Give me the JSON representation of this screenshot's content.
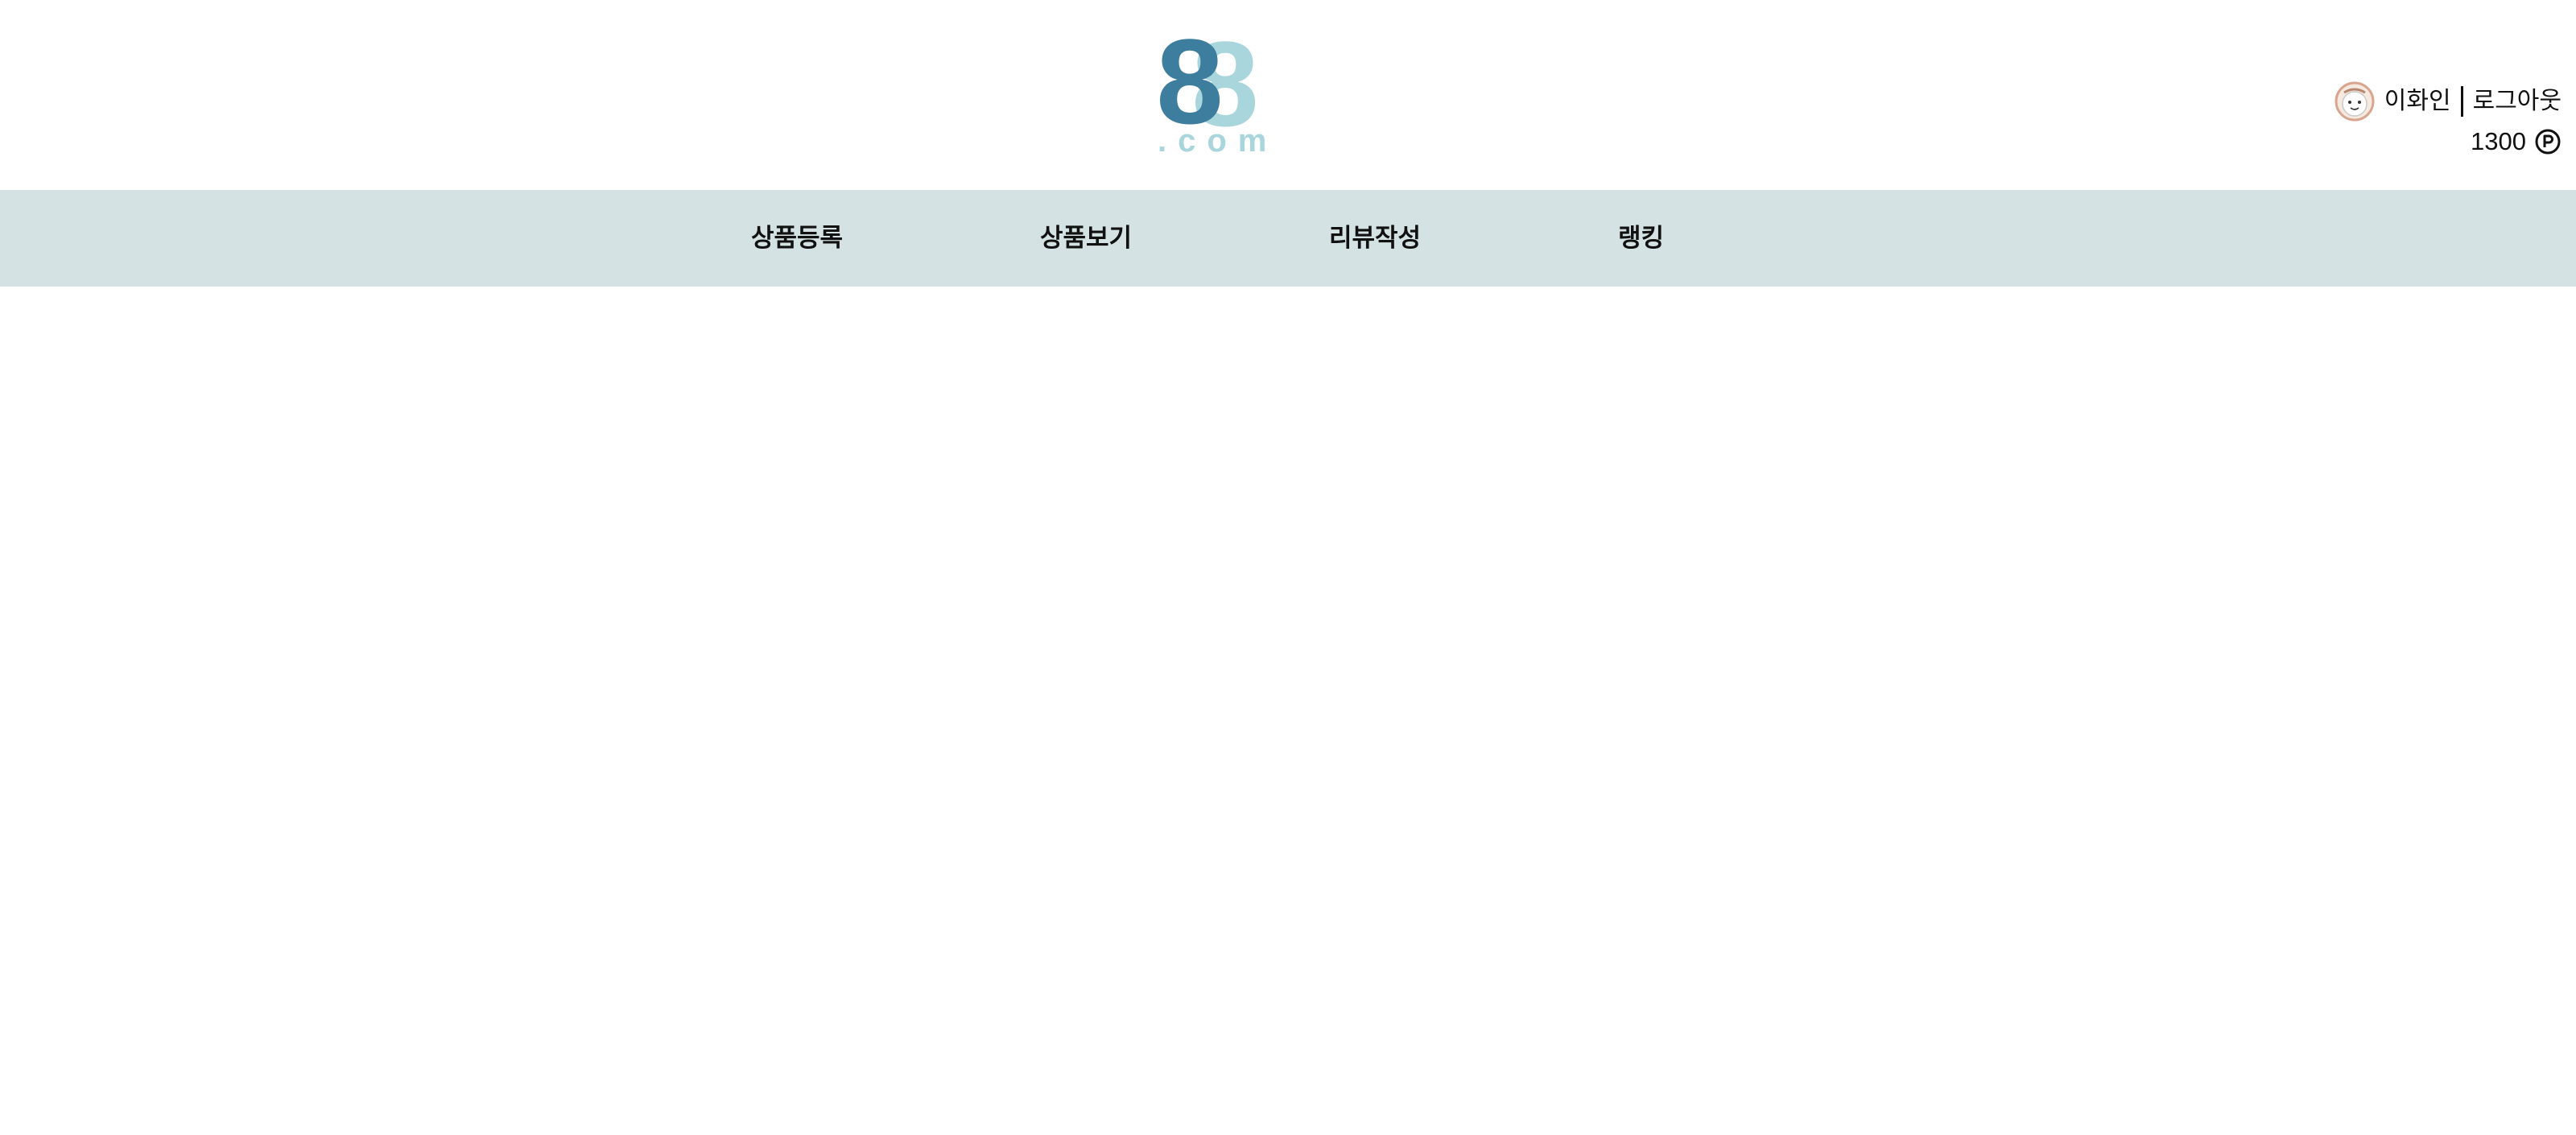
{
  "header": {
    "logo": {
      "main_digit": "8",
      "ghost_digit": "8",
      "suffix": ".com",
      "colors": {
        "primary": "#3d7d9d",
        "secondary": "#a9d6dc"
      },
      "icon": "logo-88-com"
    },
    "user": {
      "avatar_icon": "avatar-face-icon",
      "name": "이화인",
      "logout_label": "로그아웃",
      "points": "1300",
      "point_icon": "point-p-icon"
    }
  },
  "nav": {
    "background": "#d4e2e3",
    "items": [
      {
        "label": "상품등록"
      },
      {
        "label": "상품보기"
      },
      {
        "label": "리뷰작성"
      },
      {
        "label": "랭킹"
      }
    ]
  }
}
